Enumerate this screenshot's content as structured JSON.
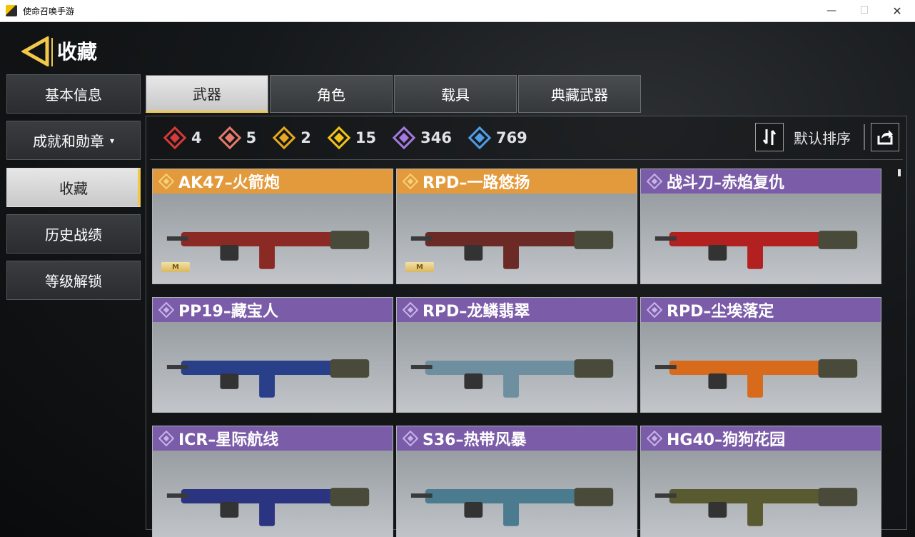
{
  "window": {
    "title": "使命召唤手游",
    "min_glyph": "—",
    "max_glyph": "☐",
    "close_glyph": "✕"
  },
  "page": {
    "title": "收藏"
  },
  "sidebar": {
    "items": [
      {
        "label": "基本信息"
      },
      {
        "label": "成就和勋章",
        "caret": "▾"
      },
      {
        "label": "收藏"
      },
      {
        "label": "历史战绩"
      },
      {
        "label": "等级解锁"
      }
    ]
  },
  "tabs": [
    {
      "label": "武器"
    },
    {
      "label": "角色"
    },
    {
      "label": "载具"
    },
    {
      "label": "典藏武器"
    }
  ],
  "counts": [
    {
      "value": "4",
      "color": "#d63a3a",
      "icon": "mythic-rank-icon"
    },
    {
      "value": "5",
      "color": "#e57a6a",
      "icon": "legendary-red-rank-icon"
    },
    {
      "value": "2",
      "color": "#e8a91e",
      "icon": "legendary-rank-icon"
    },
    {
      "value": "15",
      "color": "#f2c418",
      "icon": "epic-gold-rank-icon"
    },
    {
      "value": "346",
      "color": "#a57ae0",
      "icon": "epic-purple-rank-icon"
    },
    {
      "value": "769",
      "color": "#4f9de8",
      "icon": "rare-blue-rank-icon"
    }
  ],
  "sort": {
    "label": "默认排序"
  },
  "cards": [
    {
      "name": "AK47–火箭炮",
      "rarity": "gold",
      "badge": "M",
      "color": "#8b2a25"
    },
    {
      "name": "RPD–一路悠扬",
      "rarity": "gold",
      "badge": "M",
      "color": "#6b2a25"
    },
    {
      "name": "战斗刀–赤焰复仇",
      "rarity": "purple",
      "color": "#b22020"
    },
    {
      "name": "PP19–藏宝人",
      "rarity": "purple",
      "color": "#2a3f8a"
    },
    {
      "name": "RPD–龙鳞翡翠",
      "rarity": "purple",
      "color": "#6e8fa0"
    },
    {
      "name": "RPD–尘埃落定",
      "rarity": "purple",
      "color": "#d86a1c"
    },
    {
      "name": "ICR–星际航线",
      "rarity": "purple",
      "color": "#2a3480"
    },
    {
      "name": "S36–热带风暴",
      "rarity": "purple",
      "color": "#4a7b8f"
    },
    {
      "name": "HG40–狗狗花园",
      "rarity": "purple",
      "color": "#5a5a30"
    }
  ]
}
